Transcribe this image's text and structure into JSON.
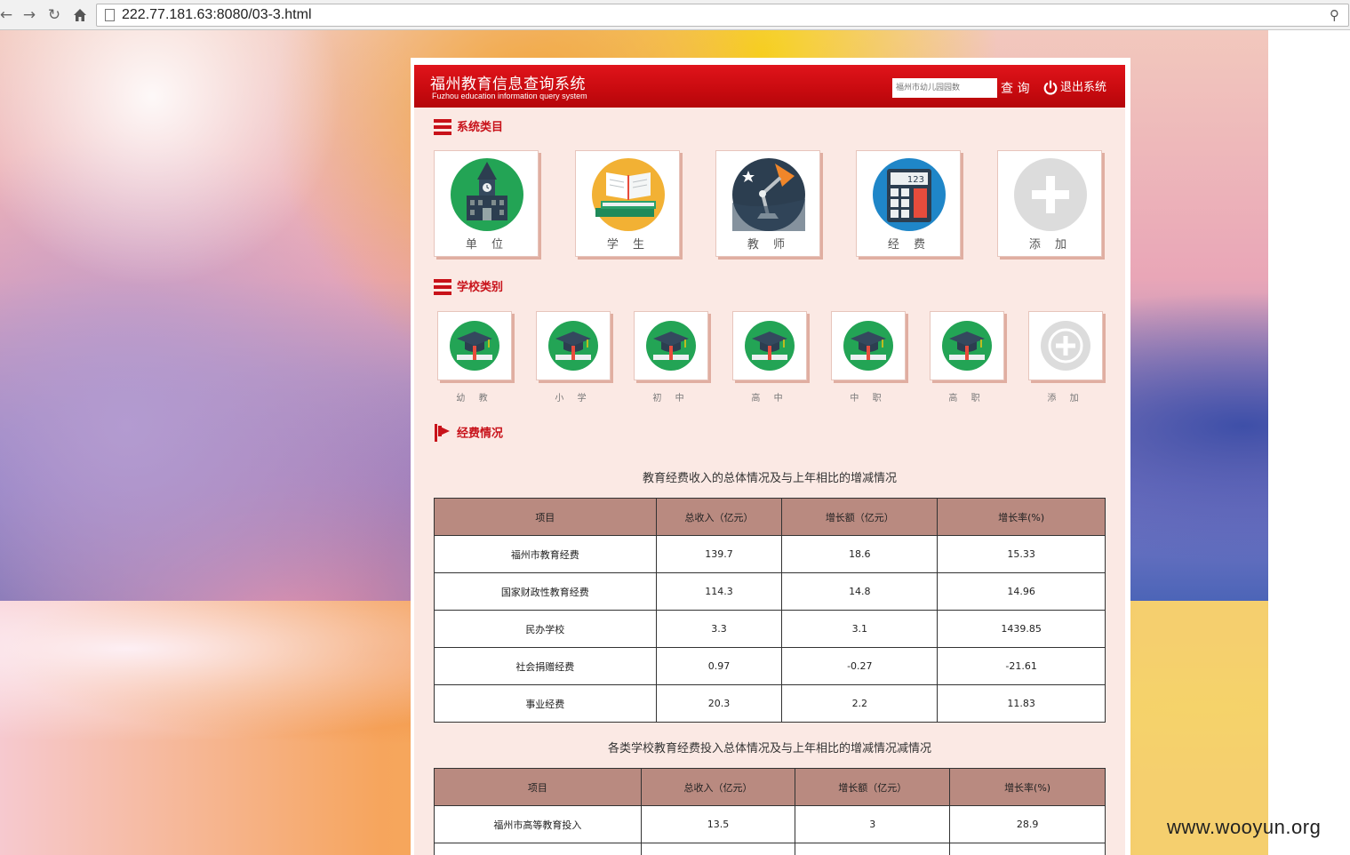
{
  "browser": {
    "url": "222.77.181.63:8080/03-3.html",
    "back_icon": "arrow-left-icon",
    "forward_icon": "arrow-right-icon",
    "reload_icon": "reload-icon",
    "home_icon": "home-icon"
  },
  "header": {
    "title": "福州教育信息查询系统",
    "subtitle": "Fuzhou education information query system",
    "search_placeholder": "福州市幼儿园园数",
    "search_label": "查 询",
    "logout_label": "退出系统"
  },
  "categories": {
    "title": "系统类目",
    "items": [
      {
        "label": "单 位",
        "icon": "school-building-icon"
      },
      {
        "label": "学 生",
        "icon": "books-icon"
      },
      {
        "label": "教 师",
        "icon": "desk-lamp-icon"
      },
      {
        "label": "经 费",
        "icon": "calculator-icon"
      },
      {
        "label": "添 加",
        "icon": "plus-icon"
      }
    ]
  },
  "school_types": {
    "title": "学校类别",
    "items": [
      {
        "label": "幼 教",
        "icon": "graduation-cap-icon"
      },
      {
        "label": "小 学",
        "icon": "graduation-cap-icon"
      },
      {
        "label": "初 中",
        "icon": "graduation-cap-icon"
      },
      {
        "label": "高 中",
        "icon": "graduation-cap-icon"
      },
      {
        "label": "中 职",
        "icon": "graduation-cap-icon"
      },
      {
        "label": "高 职",
        "icon": "graduation-cap-icon"
      },
      {
        "label": "添 加",
        "icon": "plus-circle-icon"
      }
    ]
  },
  "funding": {
    "title": "经费情况",
    "table1": {
      "caption": "教育经费收入的总体情况及与上年相比的增减情况",
      "headers": [
        "项目",
        "总收入（亿元）",
        "增长额（亿元）",
        "增长率(%)"
      ],
      "rows": [
        [
          "福州市教育经费",
          "139.7",
          "18.6",
          "15.33"
        ],
        [
          "国家财政性教育经费",
          "114.3",
          "14.8",
          "14.96"
        ],
        [
          "民办学校",
          "3.3",
          "3.1",
          "1439.85"
        ],
        [
          "社会捐赠经费",
          "0.97",
          "-0.27",
          "-21.61"
        ],
        [
          "事业经费",
          "20.3",
          "2.2",
          "11.83"
        ]
      ]
    },
    "table2": {
      "caption": "各类学校教育经费投入总体情况及与上年相比的增减情况减情况",
      "headers": [
        "项目",
        "总收入（亿元）",
        "增长额（亿元）",
        "增长率(%)"
      ],
      "rows": [
        [
          "福州市高等教育投入",
          "13.5",
          "3",
          "28.9"
        ],
        [
          "",
          "",
          "",
          ""
        ]
      ]
    }
  },
  "watermark": "www.wooyun.org",
  "colors": {
    "brand_red": "#c8121a",
    "header_red": "#e0141b",
    "panel_bg": "#fbe9e4",
    "table_header": "#b98a80",
    "icon_green": "#23a455"
  }
}
